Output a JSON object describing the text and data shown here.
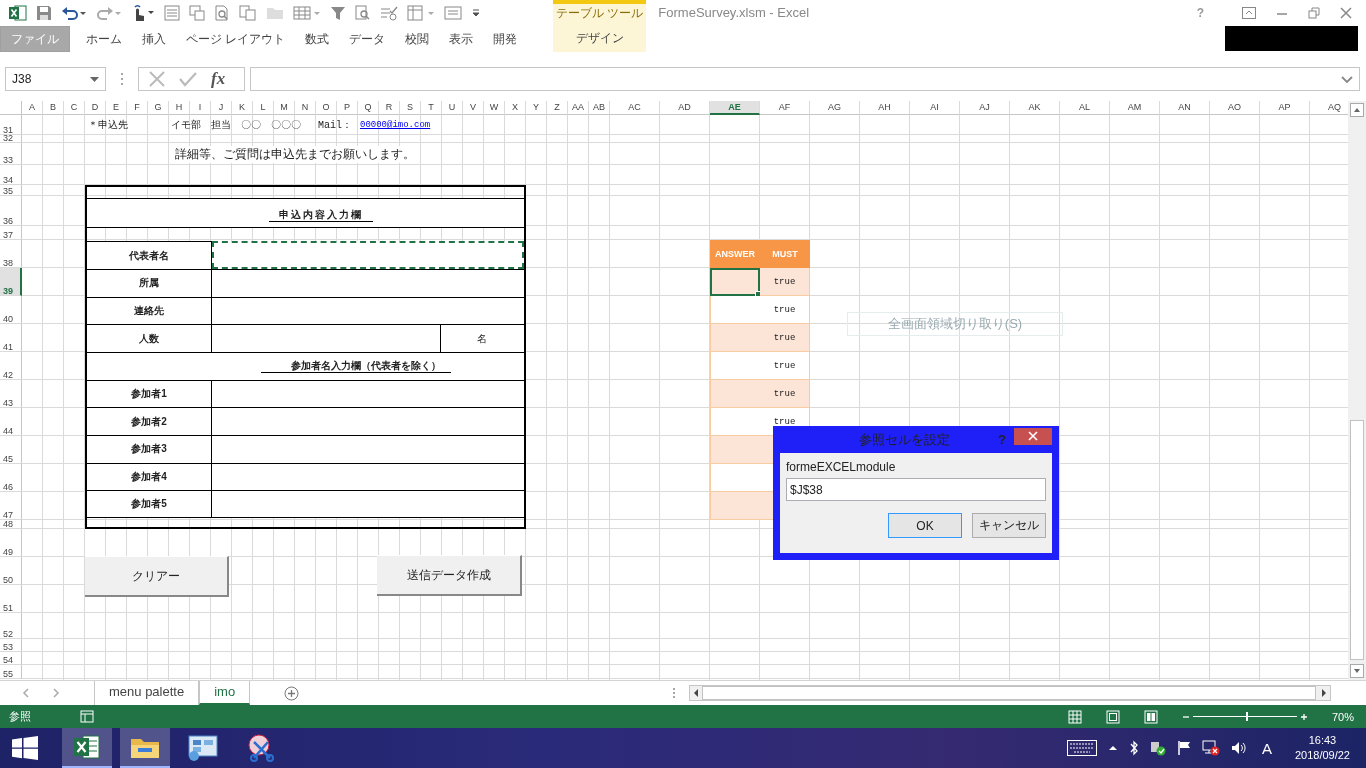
{
  "title_bar": {
    "title": "FormeSurvey.xlsm - Excel",
    "context_header": "テーブル ツール",
    "help": "?"
  },
  "ribbon_tabs": [
    {
      "label": "ファイル",
      "kind": "file",
      "selected": false
    },
    {
      "label": "ホーム",
      "kind": "tab",
      "selected": false
    },
    {
      "label": "挿入",
      "kind": "tab",
      "selected": false
    },
    {
      "label": "ページ レイアウト",
      "kind": "tab",
      "selected": false
    },
    {
      "label": "数式",
      "kind": "tab",
      "selected": false
    },
    {
      "label": "データ",
      "kind": "tab",
      "selected": false
    },
    {
      "label": "校閲",
      "kind": "tab",
      "selected": false
    },
    {
      "label": "表示",
      "kind": "tab",
      "selected": false
    },
    {
      "label": "開発",
      "kind": "tab",
      "selected": false
    },
    {
      "label": "デザイン",
      "kind": "context",
      "selected": false
    }
  ],
  "formula_bar": {
    "name_box": "J38",
    "fx_label": "fx"
  },
  "columns": [
    {
      "label": "A",
      "selected": false
    },
    {
      "label": "B",
      "selected": false
    },
    {
      "label": "C",
      "selected": false
    },
    {
      "label": "D",
      "selected": false
    },
    {
      "label": "E",
      "selected": false
    },
    {
      "label": "F",
      "selected": false
    },
    {
      "label": "G",
      "selected": false
    },
    {
      "label": "H",
      "selected": false
    },
    {
      "label": "I",
      "selected": false
    },
    {
      "label": "J",
      "selected": false
    },
    {
      "label": "K",
      "selected": false
    },
    {
      "label": "L",
      "selected": false
    },
    {
      "label": "M",
      "selected": false
    },
    {
      "label": "N",
      "selected": false
    },
    {
      "label": "O",
      "selected": false
    },
    {
      "label": "P",
      "selected": false
    },
    {
      "label": "Q",
      "selected": false
    },
    {
      "label": "R",
      "selected": false
    },
    {
      "label": "S",
      "selected": false
    },
    {
      "label": "T",
      "selected": false
    },
    {
      "label": "U",
      "selected": false
    },
    {
      "label": "V",
      "selected": false
    },
    {
      "label": "W",
      "selected": false
    },
    {
      "label": "X",
      "selected": false
    },
    {
      "label": "Y",
      "selected": false
    },
    {
      "label": "Z",
      "selected": false
    },
    {
      "label": "AA",
      "selected": false
    },
    {
      "label": "AB",
      "selected": false
    },
    {
      "label": "AC",
      "selected": false
    },
    {
      "label": "AD",
      "selected": false
    },
    {
      "label": "AE",
      "selected": true
    },
    {
      "label": "AF",
      "selected": false
    },
    {
      "label": "AG",
      "selected": false
    },
    {
      "label": "AH",
      "selected": false
    },
    {
      "label": "AI",
      "selected": false
    },
    {
      "label": "AJ",
      "selected": false
    },
    {
      "label": "AK",
      "selected": false
    },
    {
      "label": "AL",
      "selected": false
    },
    {
      "label": "AM",
      "selected": false
    },
    {
      "label": "AN",
      "selected": false
    },
    {
      "label": "AO",
      "selected": false
    },
    {
      "label": "AP",
      "selected": false
    },
    {
      "label": "AQ",
      "selected": false
    }
  ],
  "rows": [
    {
      "label": "31",
      "selected": false
    },
    {
      "label": "32",
      "selected": false
    },
    {
      "label": "33",
      "selected": false
    },
    {
      "label": "34",
      "selected": false
    },
    {
      "label": "35",
      "selected": false
    },
    {
      "label": "36",
      "selected": false
    },
    {
      "label": "37",
      "selected": false
    },
    {
      "label": "38",
      "selected": false
    },
    {
      "label": "39",
      "selected": true
    },
    {
      "label": "40",
      "selected": false
    },
    {
      "label": "41",
      "selected": false
    },
    {
      "label": "42",
      "selected": false
    },
    {
      "label": "43",
      "selected": false
    },
    {
      "label": "44",
      "selected": false
    },
    {
      "label": "45",
      "selected": false
    },
    {
      "label": "46",
      "selected": false
    },
    {
      "label": "47",
      "selected": false
    },
    {
      "label": "48",
      "selected": false
    },
    {
      "label": "49",
      "selected": false
    },
    {
      "label": "50",
      "selected": false
    },
    {
      "label": "51",
      "selected": false
    },
    {
      "label": "52",
      "selected": false
    },
    {
      "label": "53",
      "selected": false
    },
    {
      "label": "54",
      "selected": false
    },
    {
      "label": "55",
      "selected": false
    }
  ],
  "contact": {
    "label": "＊申込先",
    "department": "イモ部　担当　〇〇　〇〇〇",
    "mail_label": "Mail：",
    "mail": "00000@imo.com"
  },
  "note": "詳細等、ご質問は申込先までお願いします。",
  "form": {
    "title": "申込内容入力欄",
    "rows": [
      {
        "kind": "field",
        "label": "代表者名",
        "marquee": true
      },
      {
        "kind": "field",
        "label": "所属",
        "marquee": false
      },
      {
        "kind": "field",
        "label": "連絡先",
        "marquee": false
      },
      {
        "kind": "count",
        "label": "人数",
        "unit": "名",
        "marquee": false
      },
      {
        "kind": "section",
        "label": "参加者名入力欄（代表者を除く）"
      },
      {
        "kind": "field",
        "label": "参加者1",
        "marquee": false
      },
      {
        "kind": "field",
        "label": "参加者2",
        "marquee": false
      },
      {
        "kind": "field",
        "label": "参加者3",
        "marquee": false
      },
      {
        "kind": "field",
        "label": "参加者4",
        "marquee": false
      },
      {
        "kind": "field",
        "label": "参加者5",
        "marquee": false
      }
    ]
  },
  "sheet_buttons": [
    "クリアー",
    "送信データ作成"
  ],
  "check_table": {
    "columns": [
      "ANSWER",
      "MUST"
    ],
    "rows": [
      {
        "selected": true,
        "must": "true"
      },
      {
        "selected": false,
        "must": "true"
      },
      {
        "selected": false,
        "must": "true"
      },
      {
        "selected": false,
        "must": "true"
      },
      {
        "selected": false,
        "must": "true"
      },
      {
        "selected": false,
        "must": "true"
      },
      {
        "selected": false
      },
      {
        "selected": false
      },
      {
        "selected": false
      }
    ]
  },
  "tooltip": "全画面領域切り取り(S)",
  "dialog": {
    "title": "参照セルを設定",
    "help": "?",
    "prompt": "formeEXCELmodule",
    "value": "$J$38",
    "buttons": [
      {
        "label": "OK",
        "default": true
      },
      {
        "label": "キャンセル",
        "default": false
      }
    ]
  },
  "sheet_tabs": [
    {
      "label": "menu palette",
      "selected": false
    },
    {
      "label": "imo",
      "selected": true
    }
  ],
  "status_bar": {
    "mode": "参照",
    "zoom": {
      "level": 0.52,
      "reading": "70%"
    }
  },
  "taskbar": {
    "apps": [
      {
        "kind": "excel",
        "running": true
      },
      {
        "kind": "explorer",
        "running": true
      },
      {
        "kind": "panel",
        "running": false
      },
      {
        "kind": "snip",
        "running": false
      }
    ],
    "ime": "A",
    "time": "16:43",
    "date": "2018/09/22"
  }
}
